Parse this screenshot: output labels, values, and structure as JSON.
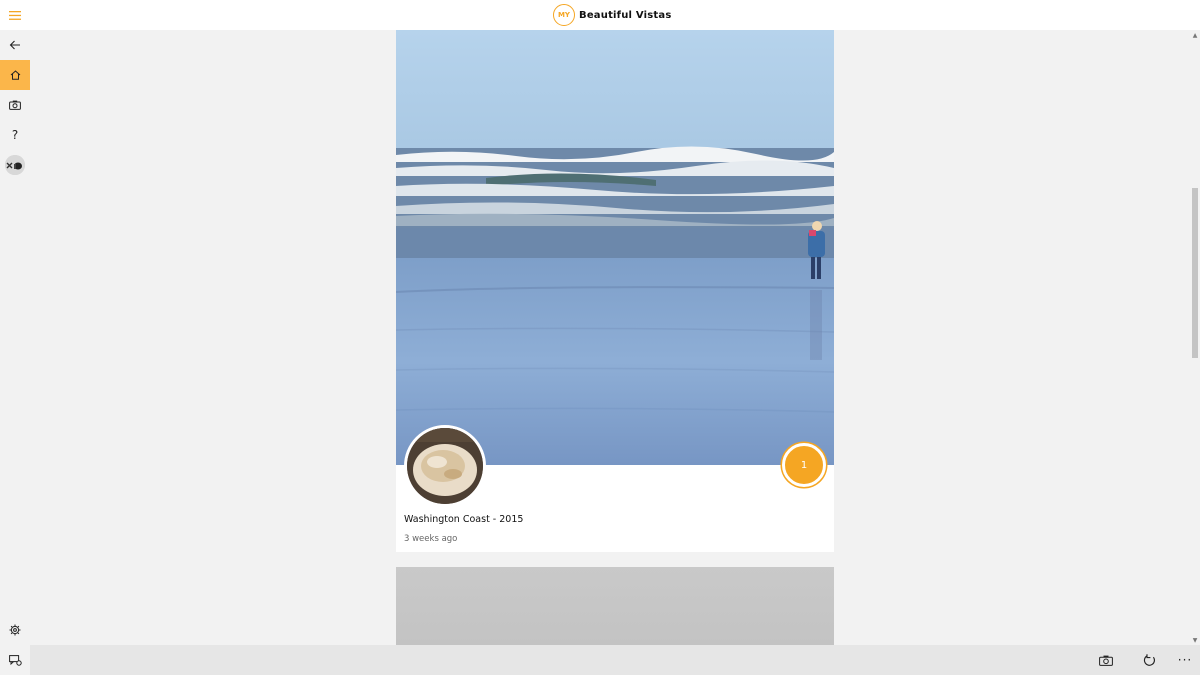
{
  "app": {
    "logo_badge": "MY",
    "title": "Beautiful Vistas",
    "accent_color": "#f5a623"
  },
  "rail": {
    "items": [
      {
        "icon": "back-arrow-icon"
      },
      {
        "icon": "home-icon",
        "active": true
      },
      {
        "icon": "camera-icon"
      },
      {
        "icon": "help-icon",
        "label": "?"
      },
      {
        "icon": "user-avatar"
      }
    ],
    "bottom": [
      {
        "icon": "gear-icon"
      },
      {
        "icon": "feedback-icon"
      }
    ]
  },
  "feed": {
    "cards": [
      {
        "title": "Washington Coast - 2015",
        "time": "3 weeks ago",
        "count": "1",
        "photo": "beach-with-child-photo",
        "thumb": "coral-closeup-photo"
      },
      {
        "photo": "overcast-sky-photo"
      }
    ]
  },
  "commandbar": {
    "items": [
      {
        "icon": "camera-icon"
      },
      {
        "icon": "refresh-icon"
      },
      {
        "icon": "more-icon",
        "label": "···"
      }
    ]
  }
}
